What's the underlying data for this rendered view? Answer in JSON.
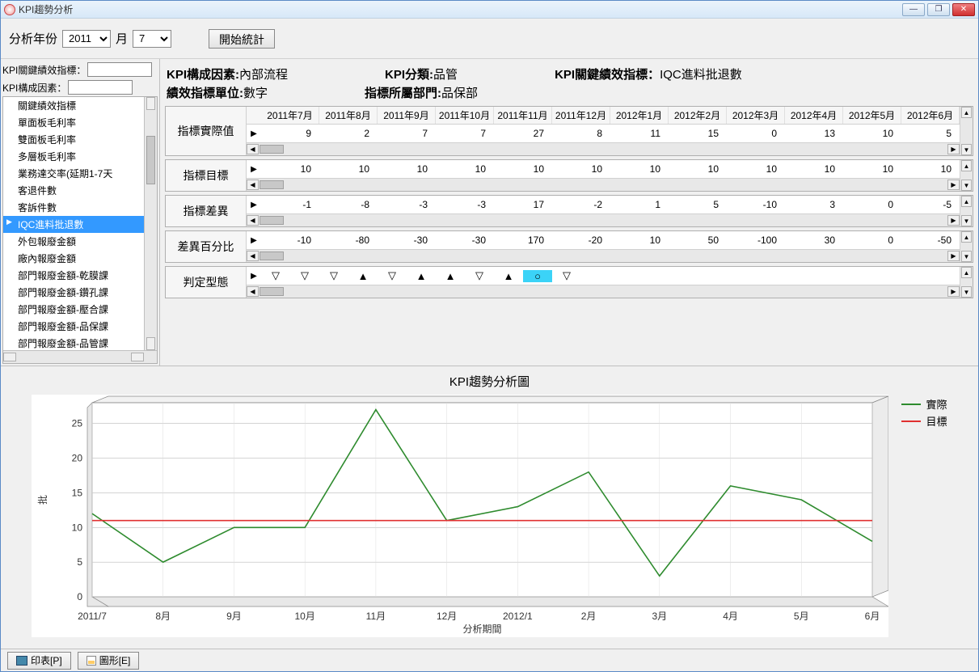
{
  "window": {
    "title": "KPI趨勢分析"
  },
  "toolbar": {
    "year_label": "分析年份",
    "year_value": "2011",
    "month_label": "月",
    "month_value": "7",
    "start_btn": "開始統計"
  },
  "filters": {
    "label_kpi_key": "KPI關鍵績效指標：",
    "label_kpi_factor": "KPI構成因素：",
    "value_kpi_key": "",
    "value_kpi_factor": ""
  },
  "kpi_list": {
    "items": [
      "關鍵績效指標",
      "單面板毛利率",
      "雙面板毛利率",
      "多層板毛利率",
      "業務達交率(延期1-7天",
      "客退件數",
      "客訴件數",
      "IQC進料批退數",
      "外包報廢金額",
      "廠內報廢金額",
      "部門報廢金額-乾膜課",
      "部門報廢金額-鑽孔課",
      "部門報廢金額-壓合課",
      "部門報廢金額-品保課",
      "部門報廢金額-品管課"
    ],
    "selected_index": 7
  },
  "info": {
    "factor_label": "KPI構成因素:",
    "factor_value": "內部流程",
    "category_label": "KPI分類:",
    "category_value": "品管",
    "kpi_label": "KPI關鍵績效指標：",
    "kpi_value": "IQC進料批退數",
    "unit_label": "績效指標單位:",
    "unit_value": "數字",
    "dept_label": "指標所屬部門:",
    "dept_value": "品保部"
  },
  "columns": [
    "2011年7月",
    "2011年8月",
    "2011年9月",
    "2011年10月",
    "2011年11月",
    "2011年12月",
    "2012年1月",
    "2012年2月",
    "2012年3月",
    "2012年4月",
    "2012年5月",
    "2012年6月"
  ],
  "rows": {
    "actual_label": "指標實際值",
    "target_label": "指標目標",
    "diff_label": "指標差異",
    "pct_label": "差異百分比",
    "shape_label": "判定型態",
    "actual": [
      9,
      2,
      7,
      7,
      27,
      8,
      11,
      15,
      0,
      13,
      10,
      5
    ],
    "target": [
      10,
      10,
      10,
      10,
      10,
      10,
      10,
      10,
      10,
      10,
      10,
      10
    ],
    "diff": [
      -1,
      -8,
      -3,
      -3,
      17,
      -2,
      1,
      5,
      -10,
      3,
      0,
      -5
    ],
    "pct": [
      -10,
      -80,
      -30,
      -30,
      170,
      -20,
      10,
      50,
      -100,
      30,
      0,
      -50
    ],
    "shapes": [
      "▽",
      "▽",
      "▽",
      "▲",
      "▽",
      "▲",
      "▲",
      "▽",
      "▲",
      "○",
      "▽"
    ],
    "shape_selected_index": 9
  },
  "chart_data": {
    "type": "line",
    "title": "KPI趨勢分析圖",
    "xlabel": "分析期間",
    "ylabel": "批",
    "categories": [
      "2011/7",
      "8月",
      "9月",
      "10月",
      "11月",
      "12月",
      "2012/1",
      "2月",
      "3月",
      "4月",
      "5月",
      "6月"
    ],
    "series": [
      {
        "name": "實際",
        "color": "#2e8b2e",
        "values": [
          12,
          5,
          10,
          10,
          27,
          11,
          13,
          18,
          3,
          16,
          14,
          8
        ]
      },
      {
        "name": "目標",
        "color": "#e03030",
        "values": [
          11,
          11,
          11,
          11,
          11,
          11,
          11,
          11,
          11,
          11,
          11,
          11
        ]
      }
    ],
    "ylim": [
      0,
      28
    ],
    "yticks": [
      0,
      5,
      10,
      15,
      20,
      25
    ]
  },
  "bottombar": {
    "print_btn": "印表[P]",
    "export_btn": "圖形[E]"
  },
  "winbtns": {
    "min": "—",
    "max": "❐",
    "close": "✕"
  }
}
